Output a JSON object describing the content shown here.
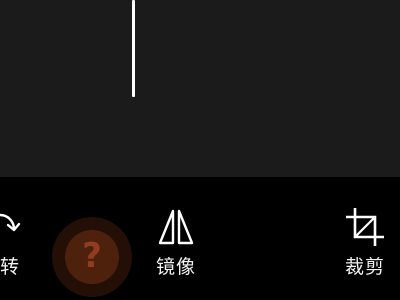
{
  "toolbar": {
    "tools": [
      {
        "label": "旋转",
        "icon": "rotate-icon"
      },
      {
        "label": "镜像",
        "icon": "mirror-icon"
      },
      {
        "label": "裁剪",
        "icon": "crop-icon"
      }
    ]
  },
  "help": {
    "glyph": "?",
    "icon": "help-icon"
  },
  "colors": {
    "canvas_background": "#1b1b1b",
    "toolbar_background": "#000000",
    "foreground": "#ffffff",
    "help_accent": "#a04619"
  }
}
